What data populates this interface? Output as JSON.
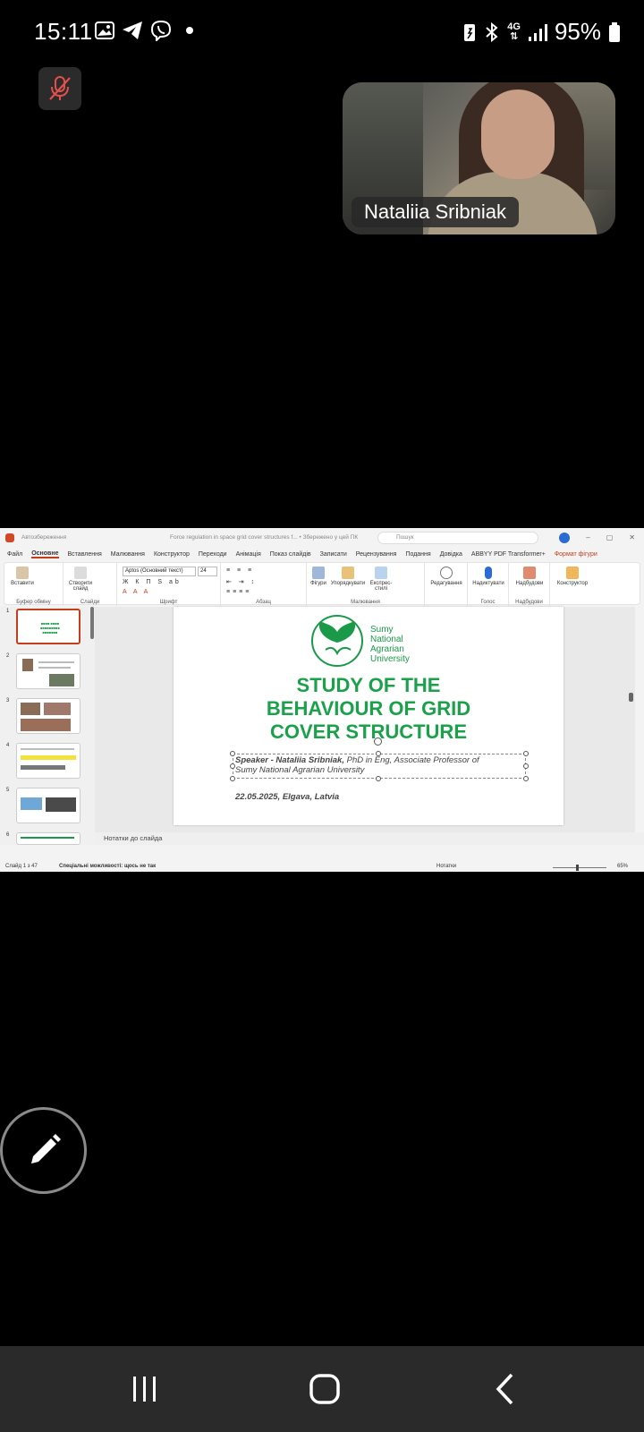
{
  "status_bar": {
    "time": "15:11",
    "network": "4G",
    "battery": "95%",
    "icons": [
      "gallery-icon",
      "telegram-icon",
      "viber-icon",
      "dot-icon",
      "battery-saver-icon",
      "bluetooth-icon",
      "signal-icon",
      "battery-icon"
    ]
  },
  "meeting": {
    "participant_name": "Nataliia Sribniak",
    "mic_state": "muted"
  },
  "powerpoint": {
    "autosave_label": "Автозбереження",
    "doc_title": "Force regulation in space grid cover structures f... • Збережено у цей ПК",
    "search_placeholder": "Пошук",
    "avatar_initials": "ВС",
    "tabs": [
      "Файл",
      "Основне",
      "Вставлення",
      "Малювання",
      "Конструктор",
      "Переходи",
      "Анімація",
      "Показ слайдів",
      "Записати",
      "Рецензування",
      "Подання",
      "Довідка",
      "ABBYY PDF Transformer+",
      "Формат фігури"
    ],
    "active_tab": "Основне",
    "ribbon": {
      "groups": [
        "Буфер обміну",
        "Слайди",
        "Шрифт",
        "Абзац",
        "Малювання",
        "Голос",
        "Надбудови"
      ],
      "paste_label": "Вставити",
      "new_slide_label": "Створити слайд",
      "font_name": "Aptos (Основний текст)",
      "font_size": "24",
      "shapes_label": "Фігури",
      "arrange_label": "Упорядкувати",
      "quick_styles_label": "Експрес-стилі",
      "editing_label": "Редагування",
      "dictate_label": "Надиктувати",
      "addins_label": "Надбудови",
      "designer_label": "Конструктор"
    },
    "thumbnail_numbers": [
      "1",
      "2",
      "3",
      "4",
      "5",
      "6"
    ],
    "slide": {
      "university_line1": "Sumy",
      "university_line2": "National",
      "university_line3": "Agrarian",
      "university_line4": "University",
      "title_line1": "STUDY OF THE",
      "title_line2": "BEHAVIOUR OF GRID",
      "title_line3": "COVER STRUCTURE",
      "speaker_bold": "Speaker - Nataliia Sribniak,",
      "speaker_rest": " PhD in Eng, Associate Professor of",
      "speaker_line2": "Sumy National Agrarian University",
      "date_place": "22.05.2025, Elgava, Latvia"
    },
    "notes_placeholder": "Нотатки до слайда",
    "status_slide": "Слайд 1 з 47",
    "status_accessibility": "Спеціальні можливості: щось не так",
    "status_notes": "Нотатки",
    "status_zoom": "65%"
  },
  "colors": {
    "slide_green": "#1aa14a",
    "ppt_accent": "#c43e1c",
    "mute_red": "#e2504a"
  }
}
